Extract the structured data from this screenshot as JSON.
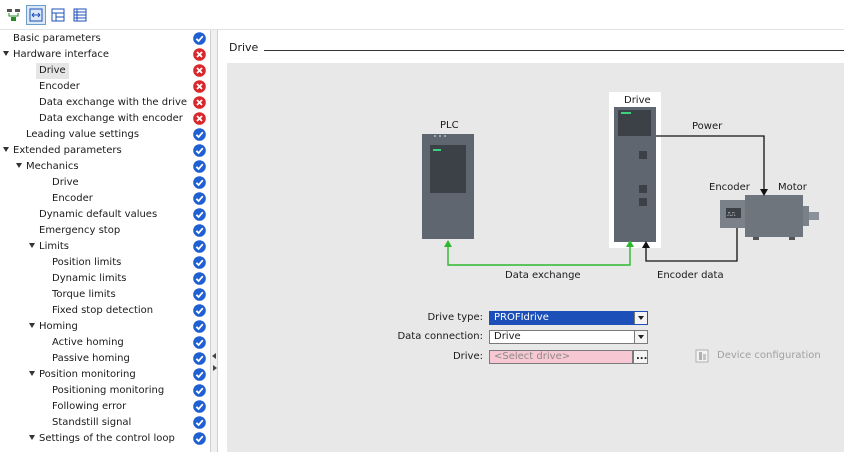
{
  "tree": {
    "items": [
      {
        "label": "Basic parameters",
        "status": "ok"
      },
      {
        "label": "Hardware interface",
        "status": "error"
      },
      {
        "label": "Drive",
        "status": "error"
      },
      {
        "label": "Encoder",
        "status": "error"
      },
      {
        "label": "Data exchange with the drive",
        "status": "error"
      },
      {
        "label": "Data exchange with encoder",
        "status": "error"
      },
      {
        "label": "Leading value settings",
        "status": "ok"
      },
      {
        "label": "Extended parameters",
        "status": "ok"
      },
      {
        "label": "Mechanics",
        "status": "ok"
      },
      {
        "label": "Drive",
        "status": "ok"
      },
      {
        "label": "Encoder",
        "status": "ok"
      },
      {
        "label": "Dynamic default values",
        "status": "ok"
      },
      {
        "label": "Emergency stop",
        "status": "ok"
      },
      {
        "label": "Limits",
        "status": "ok"
      },
      {
        "label": "Position limits",
        "status": "ok"
      },
      {
        "label": "Dynamic limits",
        "status": "ok"
      },
      {
        "label": "Torque limits",
        "status": "ok"
      },
      {
        "label": "Fixed stop detection",
        "status": "ok"
      },
      {
        "label": "Homing",
        "status": "ok"
      },
      {
        "label": "Active homing",
        "status": "ok"
      },
      {
        "label": "Passive homing",
        "status": "ok"
      },
      {
        "label": "Position monitoring",
        "status": "ok"
      },
      {
        "label": "Positioning monitoring",
        "status": "ok"
      },
      {
        "label": "Following error",
        "status": "ok"
      },
      {
        "label": "Standstill signal",
        "status": "ok"
      },
      {
        "label": "Settings of the control loop",
        "status": "ok"
      }
    ]
  },
  "section": {
    "title": "Drive"
  },
  "diagram": {
    "plc_label": "PLC",
    "drive_label": "Drive",
    "power_label": "Power",
    "encoder_label": "Encoder",
    "motor_label": "Motor",
    "data_exchange_label": "Data exchange",
    "encoder_data_label": "Encoder data"
  },
  "form": {
    "drive_type_label": "Drive type:",
    "drive_type_value": "PROFIdrive",
    "data_connection_label": "Data connection:",
    "data_connection_value": "Drive",
    "drive_label": "Drive:",
    "drive_placeholder": "<Select drive>",
    "browse_label": "...",
    "device_config_label": "Device configuration"
  },
  "colors": {
    "ok": "#1f5fd1",
    "error": "#d9282b",
    "highlight": "#1d4fb8",
    "error_field": "#f7c8d3",
    "data_line": "#2eb82e"
  }
}
